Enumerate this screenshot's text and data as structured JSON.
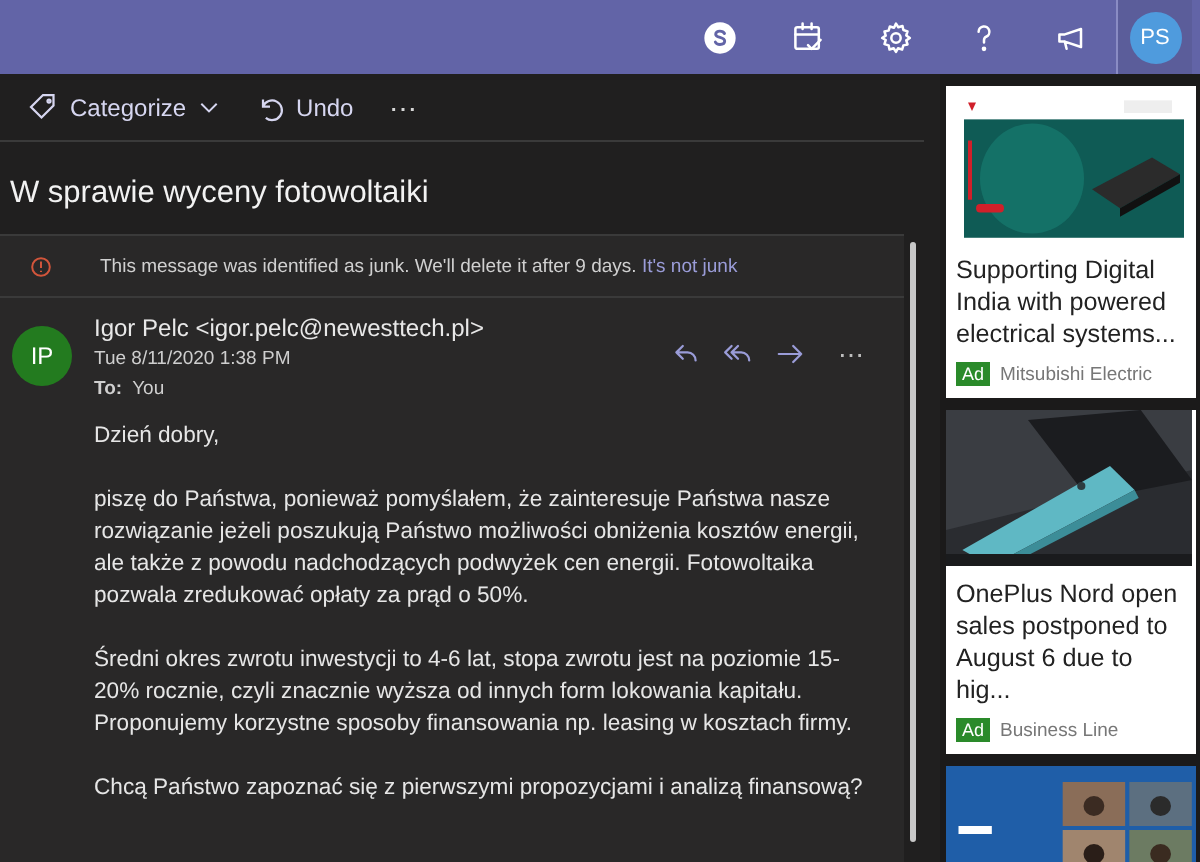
{
  "top_bar": {
    "avatar": "PS"
  },
  "toolbar": {
    "categorize": "Categorize",
    "undo": "Undo",
    "more": "⋯"
  },
  "subject": "W sprawie wyceny fotowoltaiki",
  "junk_banner": {
    "text": "This message was identified as junk. We'll delete it after 9 days.",
    "link": "It's not junk"
  },
  "message": {
    "avatar": "IP",
    "from": "Igor Pelc <igor.pelc@newesttech.pl>",
    "date": "Tue 8/11/2020 1:38 PM",
    "to_label": "To:",
    "to": "You",
    "more": "⋯",
    "body": [
      "Dzień dobry,",
      "piszę do Państwa, ponieważ pomyślałem, że zainteresuje Państwa nasze rozwiązanie jeżeli poszukują Państwo możliwości obniżenia kosztów energii, ale także z powodu nadchodzących podwyżek cen energii. Fotowoltaika pozwala zredukować opłaty za prąd o 50%.",
      "Średni okres zwrotu inwestycji to 4-6 lat, stopa zwrotu jest na poziomie 15-20% rocznie, czyli znacznie wyższa od innych form lokowania kapitału. Proponujemy korzystne sposoby finansowania np. leasing w kosztach firmy.",
      "Chcą Państwo zapoznać się z pierwszymi propozycjami i analizą finansową?"
    ]
  },
  "ads": [
    {
      "kind": "banner",
      "title": "Supporting Digital India with powered electrical systems...",
      "badge": "Ad",
      "source": "Mitsubishi Electric"
    },
    {
      "kind": "phone",
      "title": "OnePlus Nord open sales postponed to August 6 due to hig...",
      "badge": "Ad",
      "source": "Business Line"
    },
    {
      "kind": "video"
    }
  ]
}
